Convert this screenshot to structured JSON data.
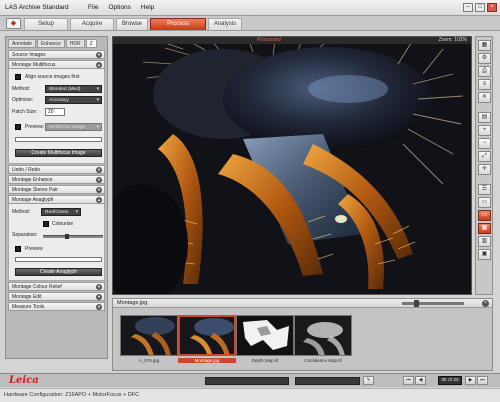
{
  "app": {
    "title": "LAS Archive Standard",
    "menu": [
      "File",
      "Options",
      "Help"
    ]
  },
  "workflow_tabs": [
    "Setup",
    "Acquire",
    "Browse",
    "Process",
    "Analysis"
  ],
  "active_workflow_tab": "Process",
  "left_panel": {
    "sub_tabs": [
      "Annotate",
      "Enhance",
      "HDR",
      "Z"
    ],
    "active_sub_tab": "Z",
    "sections": {
      "source_images": "Source Images",
      "montage_multifocus": "Montage Multifocus",
      "undo_redo": "Undo / Redo",
      "montage_enhance": "Montage Enhance",
      "montage_stereo_pair": "Montage Stereo Pair",
      "montage_anaglyph": "Montage Anaglyph",
      "montage_colour_relief": "Montage Colour Relief",
      "montage_edit": "Montage Edit",
      "measure_tools": "Measure Tools"
    },
    "multifocus": {
      "align_label": "Align source images first",
      "method_label": "Method:",
      "method_value": "Blended (Med)",
      "optimise_label": "Optimise:",
      "optimise_value": "Accuracy",
      "patch_label": "Patch Size:",
      "patch_value": "20",
      "preview_label": "Preview:",
      "preview_select": "Multifocus Image",
      "create_button": "Create Multifocus Image"
    },
    "anaglyph": {
      "method_label": "Method:",
      "method_value": "Red/Green",
      "colourise_label": "Colourise",
      "separation_label": "Separation:",
      "preview_label": "Preview",
      "create_button": "Create Anaglyph"
    }
  },
  "viewer": {
    "status": "Processed",
    "zoom": "Zoom: 102%"
  },
  "gallery": {
    "title": "Montage.jpg",
    "thumbnails": [
      {
        "caption": "A_076.jpg",
        "selected": false
      },
      {
        "caption": "Montage.jpg",
        "selected": true
      },
      {
        "caption": "Depth Map.tif",
        "selected": false
      },
      {
        "caption": "Confidence Map.tif",
        "selected": false
      }
    ]
  },
  "bottom": {
    "logo": "Leica",
    "page_indicator": "30 of 22"
  },
  "status_bar": {
    "hardware": "Hardware Configuration: Z16APO + MotorFocus + DFC"
  },
  "colors": {
    "accent": "#d2461f",
    "panel": "#b9b9b9",
    "viewer_bg": "#0e1014"
  }
}
